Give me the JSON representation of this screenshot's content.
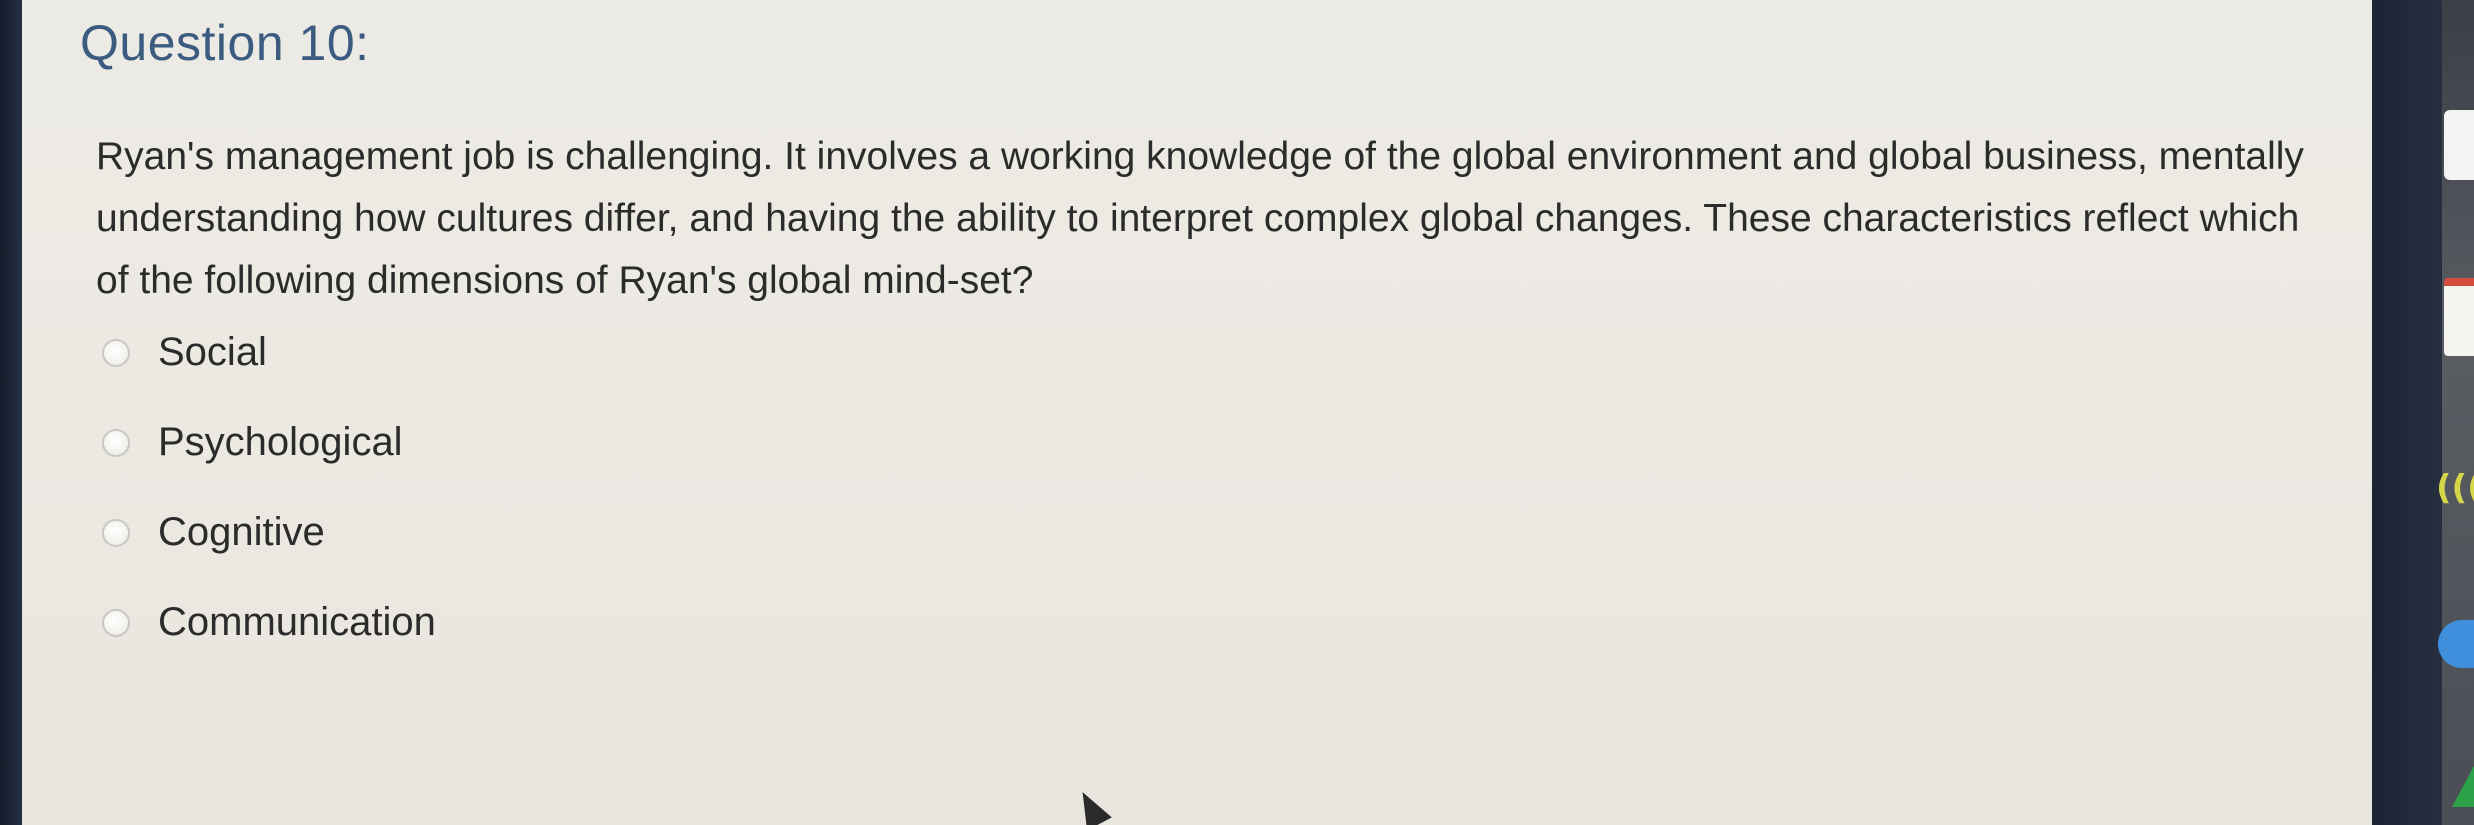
{
  "question": {
    "title": "Question 10:",
    "text": "Ryan's management job is challenging. It involves a working knowledge of the global environment and global business, mentally understanding how cultures differ, and having the ability to interpret complex global changes. These characteristics reflect which of the following dimensions of Ryan's global mind-set?"
  },
  "options": [
    {
      "label": "Social",
      "selected": false
    },
    {
      "label": "Psychological",
      "selected": false
    },
    {
      "label": "Cognitive",
      "selected": false
    },
    {
      "label": "Communication",
      "selected": false
    }
  ],
  "dock_icons": [
    "wifi-icon",
    "cloud-icon",
    "drive-icon"
  ],
  "colors": {
    "title": "#3b5c80",
    "text": "#2b2b2b",
    "background": "#ebe9e2"
  }
}
